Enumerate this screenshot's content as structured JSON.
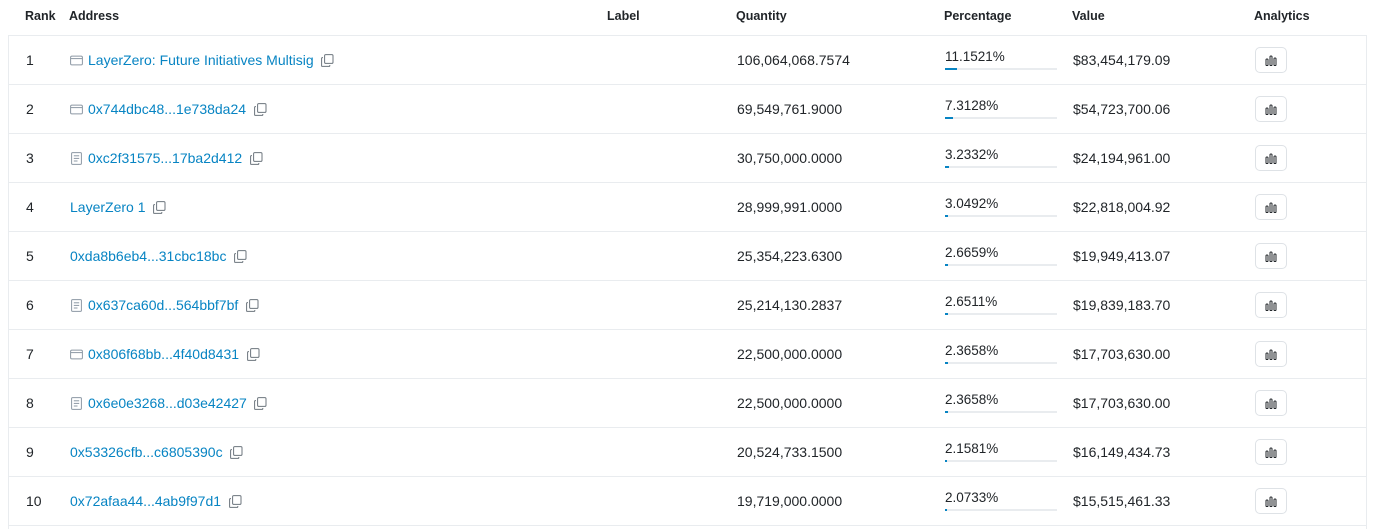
{
  "headers": {
    "rank": "Rank",
    "address": "Address",
    "label": "Label",
    "quantity": "Quantity",
    "percentage": "Percentage",
    "value": "Value",
    "analytics": "Analytics"
  },
  "colors": {
    "link": "#0784c3",
    "bar_fill": "#0784c3",
    "bar_track": "#e9ecef",
    "border": "#e9ecef"
  },
  "rows": [
    {
      "rank": "1",
      "address": "LayerZero: Future Initiatives Multisig",
      "icon": "wallet-icon",
      "quantity": "106,064,068.7574",
      "percentage": "11.1521%",
      "pct_value": 11.1521,
      "value": "$83,454,179.09"
    },
    {
      "rank": "2",
      "address": "0x744dbc48...1e738da24",
      "icon": "wallet-icon",
      "quantity": "69,549,761.9000",
      "percentage": "7.3128%",
      "pct_value": 7.3128,
      "value": "$54,723,700.06"
    },
    {
      "rank": "3",
      "address": "0xc2f31575...17ba2d412",
      "icon": "contract-icon",
      "quantity": "30,750,000.0000",
      "percentage": "3.2332%",
      "pct_value": 3.2332,
      "value": "$24,194,961.00"
    },
    {
      "rank": "4",
      "address": "LayerZero 1",
      "icon": "",
      "quantity": "28,999,991.0000",
      "percentage": "3.0492%",
      "pct_value": 3.0492,
      "value": "$22,818,004.92"
    },
    {
      "rank": "5",
      "address": "0xda8b6eb4...31cbc18bc",
      "icon": "",
      "quantity": "25,354,223.6300",
      "percentage": "2.6659%",
      "pct_value": 2.6659,
      "value": "$19,949,413.07"
    },
    {
      "rank": "6",
      "address": "0x637ca60d...564bbf7bf",
      "icon": "contract-icon",
      "quantity": "25,214,130.2837",
      "percentage": "2.6511%",
      "pct_value": 2.6511,
      "value": "$19,839,183.70"
    },
    {
      "rank": "7",
      "address": "0x806f68bb...4f40d8431",
      "icon": "wallet-icon",
      "quantity": "22,500,000.0000",
      "percentage": "2.3658%",
      "pct_value": 2.3658,
      "value": "$17,703,630.00"
    },
    {
      "rank": "8",
      "address": "0x6e0e3268...d03e42427",
      "icon": "contract-icon",
      "quantity": "22,500,000.0000",
      "percentage": "2.3658%",
      "pct_value": 2.3658,
      "value": "$17,703,630.00"
    },
    {
      "rank": "9",
      "address": "0x53326cfb...c6805390c",
      "icon": "",
      "quantity": "20,524,733.1500",
      "percentage": "2.1581%",
      "pct_value": 2.1581,
      "value": "$16,149,434.73"
    },
    {
      "rank": "10",
      "address": "0x72afaa44...4ab9f97d1",
      "icon": "",
      "quantity": "19,719,000.0000",
      "percentage": "2.0733%",
      "pct_value": 2.0733,
      "value": "$15,515,461.33"
    }
  ]
}
